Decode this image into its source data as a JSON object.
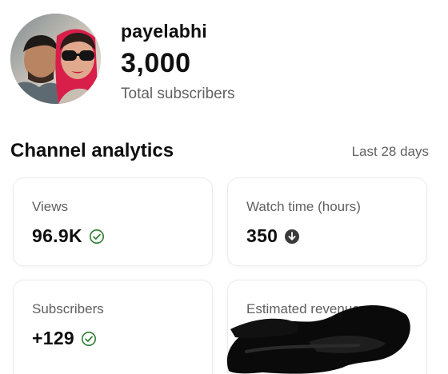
{
  "channel": {
    "name": "payelabhi",
    "subscriber_count": "3,000",
    "subscriber_label": "Total subscribers"
  },
  "analytics": {
    "title": "Channel analytics",
    "period": "Last 28 days",
    "cards": [
      {
        "label": "Views",
        "value": "96.9K",
        "status": "check-circle-icon"
      },
      {
        "label": "Watch time (hours)",
        "value": "350",
        "status": "down-arrow-circle-icon"
      },
      {
        "label": "Subscribers",
        "value": "+129",
        "status": "check-circle-icon"
      },
      {
        "label": "Estimated revenue",
        "value": "",
        "status": "redacted"
      }
    ]
  },
  "colors": {
    "check": "#2e7d32",
    "down_badge": "#3a3a3a",
    "muted_text": "#606060"
  }
}
